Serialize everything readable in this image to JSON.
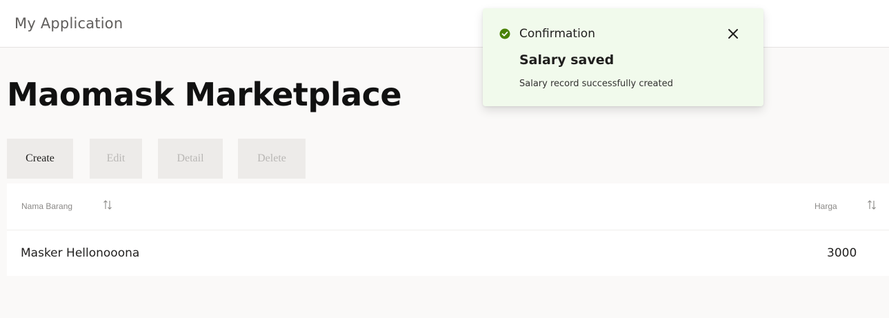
{
  "app": {
    "title": "My Application"
  },
  "page": {
    "title": "Maomask Marketplace"
  },
  "toolbar": {
    "create_label": "Create",
    "edit_label": "Edit",
    "detail_label": "Detail",
    "delete_label": "Delete"
  },
  "table": {
    "columns": [
      {
        "label": "Nama Barang",
        "sort_icon": "sort-arrows-icon"
      },
      {
        "label": "Harga",
        "sort_icon": "sort-arrows-icon"
      }
    ],
    "rows": [
      {
        "nama_barang": "Masker Hellonooona",
        "harga": "3000"
      }
    ]
  },
  "toast": {
    "title": "Confirmation",
    "heading": "Salary saved",
    "message": "Salary record successfully created",
    "status_icon": "check-circle-icon",
    "close_icon": "close-icon",
    "status_color": "#498205"
  }
}
